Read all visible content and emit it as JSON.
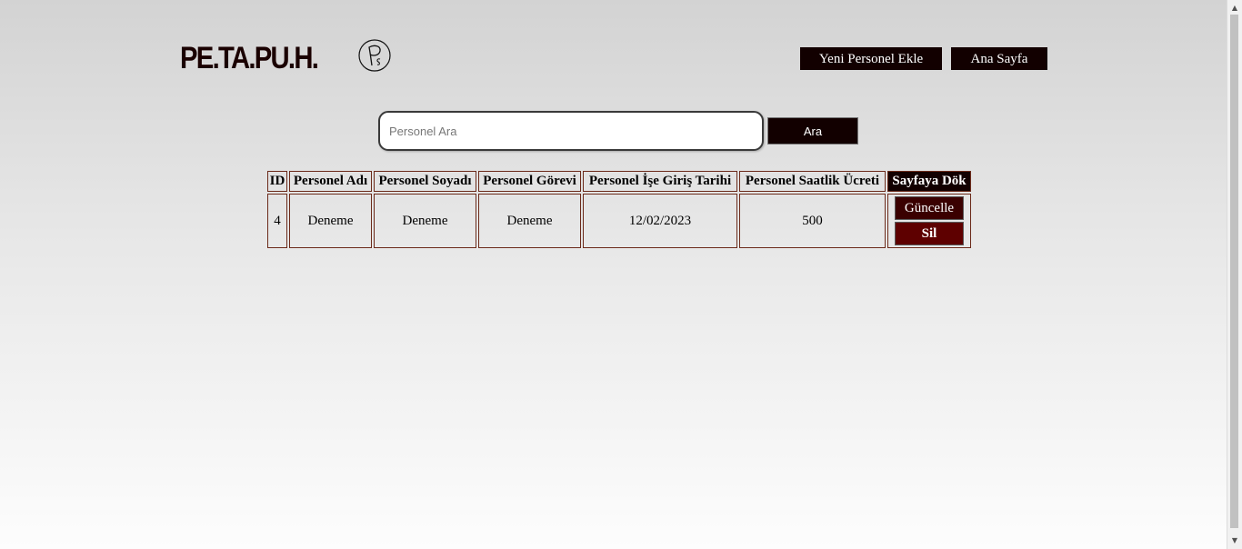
{
  "header": {
    "logo_text": "PE.TA.PU.H.",
    "emblem_icon": "ps-monogram-icon",
    "nav": {
      "add_label": "Yeni Personel Ekle",
      "home_label": "Ana Sayfa"
    }
  },
  "search": {
    "placeholder": "Personel Ara",
    "value": "",
    "button_label": "Ara"
  },
  "table": {
    "columns": [
      "ID",
      "Personel Adı",
      "Personel Soyadı",
      "Personel Görevi",
      "Personel İşe Giriş Tarihi",
      "Personel Saatlik Ücreti",
      "Sayfaya Dök"
    ],
    "rows": [
      {
        "id": "4",
        "first_name": "Deneme",
        "last_name": "Deneme",
        "role": "Deneme",
        "start_date": "12/02/2023",
        "hourly_wage": "500",
        "update_label": "Güncelle",
        "delete_label": "Sil"
      }
    ]
  },
  "colors": {
    "button_bg": "#120000",
    "update_bg": "#3a0000",
    "delete_bg": "#5e0000",
    "cell_border": "#6b2a1a"
  }
}
